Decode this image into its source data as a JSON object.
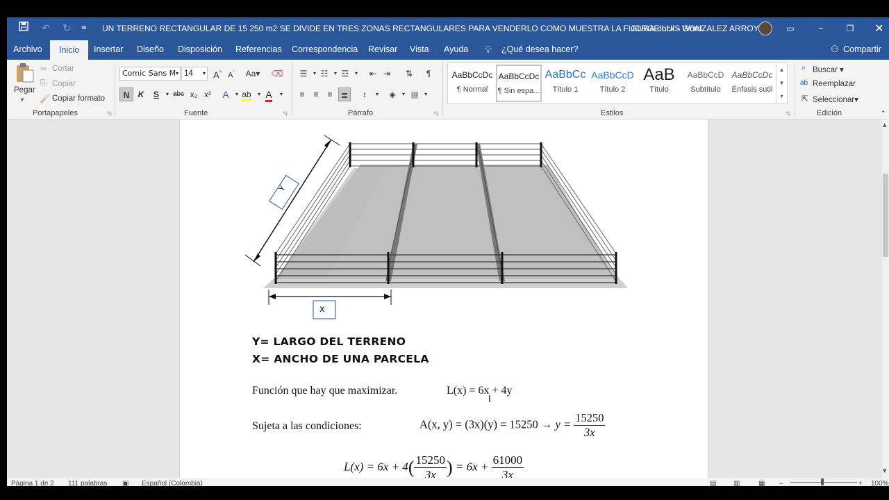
{
  "window": {
    "title": "UN TERRENO RECTANGULAR DE 15 250 m2 SE DIVIDE EN TRES ZONAS RECTANGULARES PARA VENDERLO COMO MUESTRA LA FIGURA.docx  -  Word",
    "user": "JORGE LUIS GONZALEZ ARROYO",
    "icons": [
      "save-icon",
      "undo-icon",
      "redo-icon",
      "customize-qat-icon",
      "ribbon-display-icon",
      "minimize-icon",
      "maximize-icon",
      "close-icon"
    ]
  },
  "tabs": [
    "Archivo",
    "Inicio",
    "Insertar",
    "Diseño",
    "Disposición",
    "Referencias",
    "Correspondencia",
    "Revisar",
    "Vista",
    "Ayuda"
  ],
  "tell_me": "¿Qué desea hacer?",
  "share": "Compartir",
  "ribbon": {
    "clipboard": {
      "paste": "Pegar",
      "cut": "Cortar",
      "copy": "Copiar",
      "format_painter": "Copiar formato",
      "label": "Portapapeles"
    },
    "font": {
      "name": "Comic Sans M",
      "size": "14",
      "label": "Fuente",
      "bold": "N",
      "italic": "K",
      "underline": "S",
      "strike": "abc",
      "sub": "x₂",
      "sup": "x²",
      "case": "Aa",
      "grow": "A",
      "shrink": "A"
    },
    "paragraph": {
      "label": "Párrafo"
    },
    "styles": {
      "label": "Estilos",
      "items": [
        {
          "preview": "AaBbCcDc",
          "name": "¶ Normal"
        },
        {
          "preview": "AaBbCcDc",
          "name": "¶ Sin espa..."
        },
        {
          "preview": "AaBbCc",
          "name": "Título 1"
        },
        {
          "preview": "AaBbCcD",
          "name": "Título 2"
        },
        {
          "preview": "AaB",
          "name": "Título"
        },
        {
          "preview": "AaBbCcD",
          "name": "Subtítulo"
        },
        {
          "preview": "AaBbCcDc",
          "name": "Énfasis sutil"
        }
      ]
    },
    "editing": {
      "find": "Buscar",
      "replace": "Reemplazar",
      "select": "Seleccionar",
      "label": "Edición"
    }
  },
  "document": {
    "figure": {
      "label_y": "Y",
      "label_x": "x"
    },
    "line1": "Y= LARGO DEL TERRENO",
    "line2": "X= ANCHO DE UNA PARCELA",
    "func_text": "Función que hay que maximizar.",
    "func_eq": "L(x) = 6x + 4y",
    "cond_text": "Sujeta a las condiciones:",
    "cond_eq": "A(x, y) = (3x)(y) = 15250 → ",
    "cond_y": "y = ",
    "cond_num": "15250",
    "cond_den": "3x",
    "sub_lhs": "L(x) = 6x + 4",
    "sub_num": "15250",
    "sub_den": "3x",
    "sub_mid": " = 6x + ",
    "sub_num2": "61000",
    "sub_den2": "3x"
  },
  "status": {
    "page": "Página 1 de 2",
    "words": "111 palabras",
    "language": "Español (Colombia)",
    "zoom": "100%"
  }
}
